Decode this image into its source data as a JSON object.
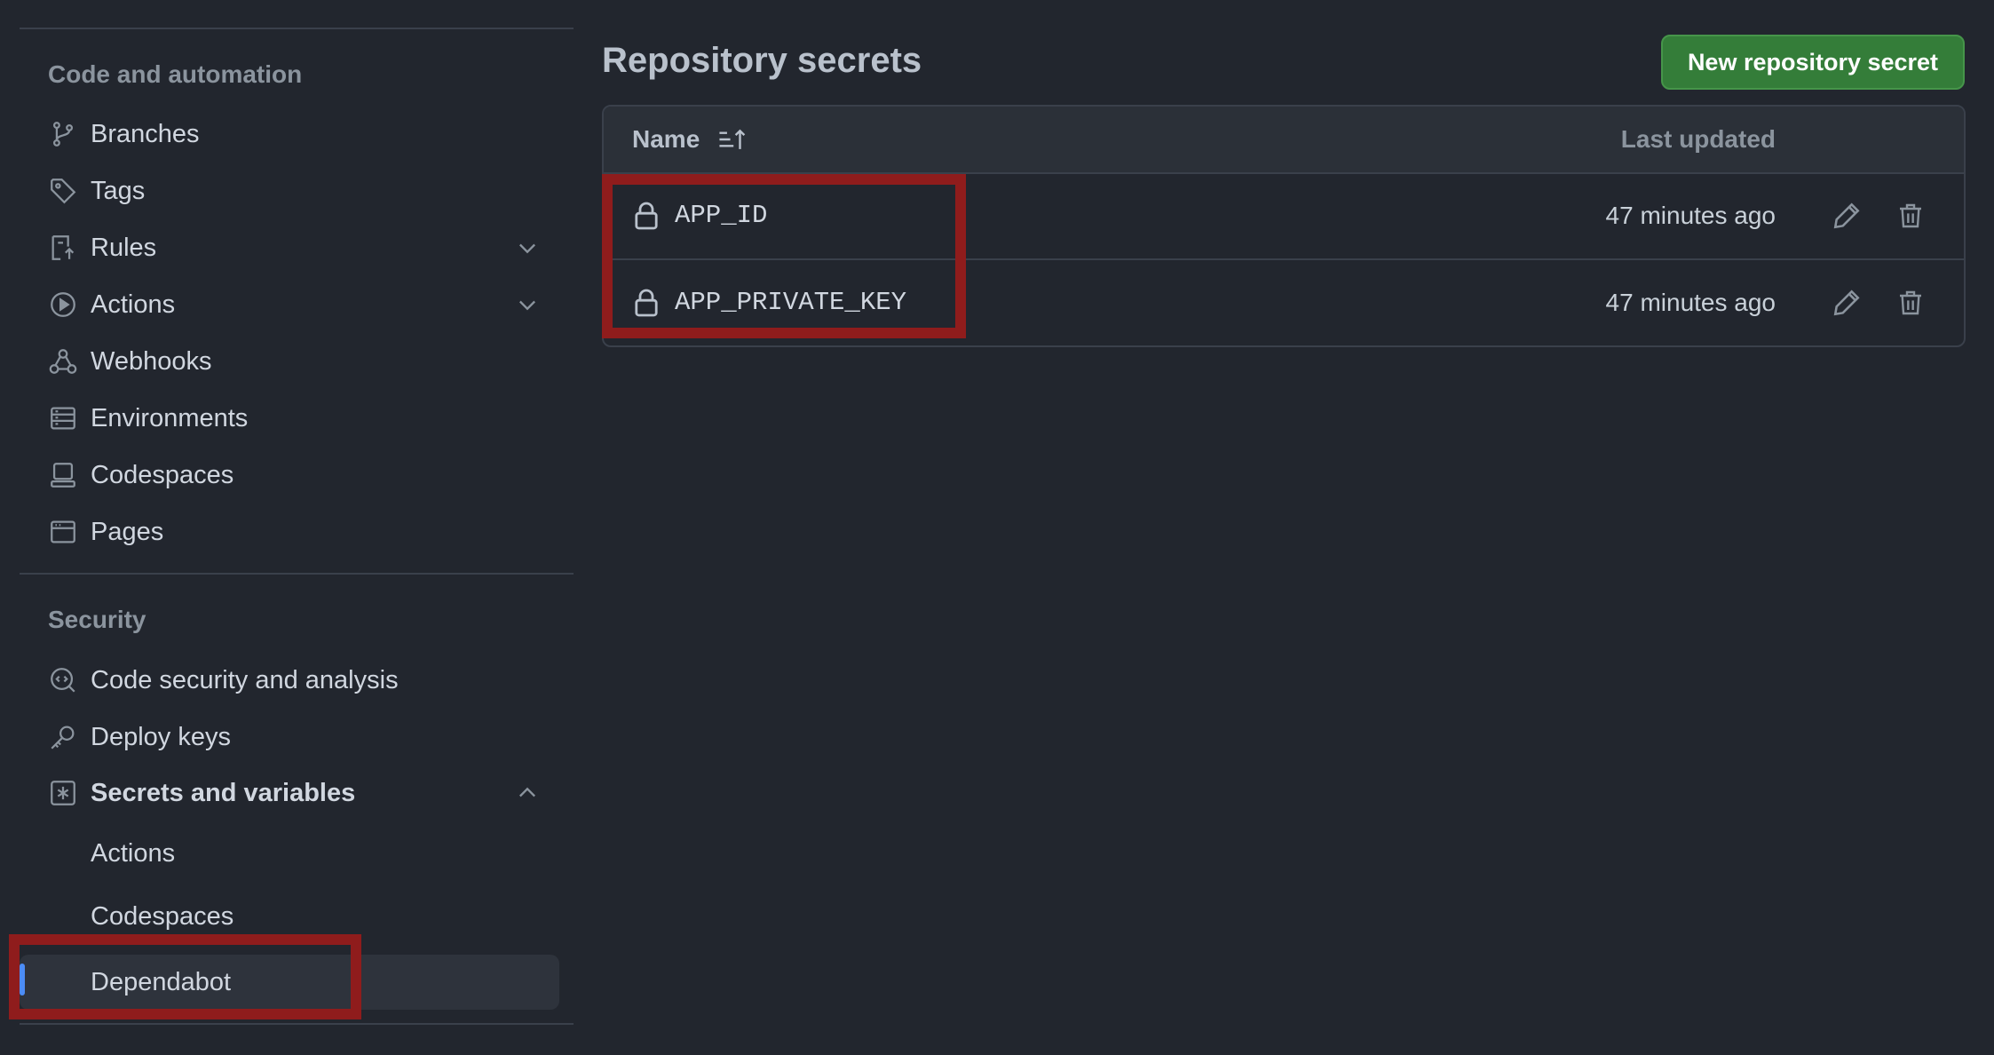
{
  "sidebar": {
    "code_section_title": "Code and automation",
    "code_items": [
      {
        "label": "Branches",
        "icon": "git-branch-icon"
      },
      {
        "label": "Tags",
        "icon": "tag-icon"
      },
      {
        "label": "Rules",
        "icon": "rules-icon",
        "expandable": true
      },
      {
        "label": "Actions",
        "icon": "play-icon",
        "expandable": true
      },
      {
        "label": "Webhooks",
        "icon": "webhook-icon"
      },
      {
        "label": "Environments",
        "icon": "server-icon"
      },
      {
        "label": "Codespaces",
        "icon": "codespaces-icon"
      },
      {
        "label": "Pages",
        "icon": "browser-icon"
      }
    ],
    "security_section_title": "Security",
    "security_items": [
      {
        "label": "Code security and analysis",
        "icon": "codescan-icon"
      },
      {
        "label": "Deploy keys",
        "icon": "key-icon"
      },
      {
        "label": "Secrets and variables",
        "icon": "asterisk-icon",
        "expanded": true
      }
    ],
    "sub_items": [
      {
        "label": "Actions"
      },
      {
        "label": "Codespaces"
      },
      {
        "label": "Dependabot",
        "selected": true
      }
    ]
  },
  "main": {
    "heading": "Repository secrets",
    "new_button_label": "New repository secret",
    "table": {
      "col_name": "Name",
      "col_updated": "Last updated",
      "rows": [
        {
          "name": "APP_ID",
          "updated": "47 minutes ago"
        },
        {
          "name": "APP_PRIVATE_KEY",
          "updated": "47 minutes ago"
        }
      ]
    }
  },
  "colors": {
    "background": "#22262e",
    "primary_button": "#347d39",
    "selected_indicator": "#4c8cf5",
    "annotation_box": "#8f1c1c"
  }
}
